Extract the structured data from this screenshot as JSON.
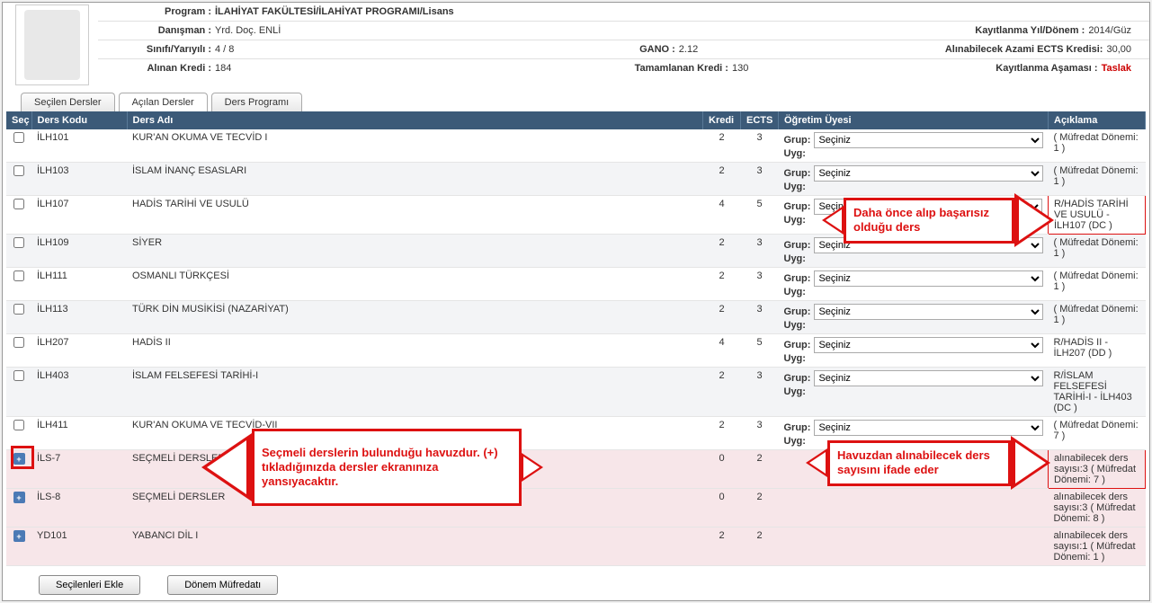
{
  "header": {
    "program_lbl": "Program :",
    "program_val": "İLAHİYAT FAKÜLTESİ/İLAHİYAT PROGRAMI/Lisans",
    "danisman_lbl": "Danışman :",
    "danisman_val": "Yrd. Doç.                ENLİ",
    "sinif_lbl": "Sınıfı/Yarıyılı :",
    "sinif_val": "4 / 8",
    "kredi_lbl": "Alınan Kredi :",
    "kredi_val": "184",
    "kayit_yil_lbl": "Kayıtlanma Yıl/Dönem :",
    "kayit_yil_val": "2014/Güz",
    "gano_lbl": "GANO :",
    "gano_val": "2.12",
    "azami_lbl": "Alınabilecek Azami ECTS Kredisi:",
    "azami_val": "30,00",
    "tamam_kredi_lbl": "Tamamlanan Kredi :",
    "tamam_kredi_val": "130",
    "asama_lbl": "Kayıtlanma Aşaması :",
    "asama_val": "Taslak"
  },
  "tabs": {
    "t1": "Seçilen Dersler",
    "t2": "Açılan Dersler",
    "t3": "Ders Programı"
  },
  "thead": {
    "sec": "Seç",
    "kod": "Ders Kodu",
    "adi": "Ders Adı",
    "kredi": "Kredi",
    "ects": "ECTS",
    "ogr": "Öğretim Üyesi",
    "acik": "Açıklama"
  },
  "grup_lbl": "Grup:",
  "uyg_lbl": "Uyg:",
  "sel_placeholder": "Seçiniz",
  "rows": [
    {
      "kod": "İLH101",
      "adi": "KUR'AN OKUMA VE TECVİD I",
      "kredi": "2",
      "ects": "3",
      "grup": true,
      "acik": "( Müfredat Dönemi: 1 )",
      "cls": "odd"
    },
    {
      "kod": "İLH103",
      "adi": "İSLAM İNANÇ ESASLARI",
      "kredi": "2",
      "ects": "3",
      "grup": true,
      "acik": "( Müfredat Dönemi: 1 )",
      "cls": "even"
    },
    {
      "kod": "İLH107",
      "adi": "HADİS TARİHİ VE USULÜ",
      "kredi": "4",
      "ects": "5",
      "grup": true,
      "acik": "R/HADİS TARİHİ VE USULÜ - İLH107 (DC )",
      "cls": "odd",
      "acik_red": true
    },
    {
      "kod": "İLH109",
      "adi": "SİYER",
      "kredi": "2",
      "ects": "3",
      "grup": true,
      "acik": "( Müfredat Dönemi: 1 )",
      "cls": "even"
    },
    {
      "kod": "İLH111",
      "adi": "OSMANLI TÜRKÇESİ",
      "kredi": "2",
      "ects": "3",
      "grup": true,
      "acik": "( Müfredat Dönemi: 1 )",
      "cls": "odd"
    },
    {
      "kod": "İLH113",
      "adi": "TÜRK DİN MUSİKİSİ (NAZARİYAT)",
      "kredi": "2",
      "ects": "3",
      "grup": true,
      "acik": "( Müfredat Dönemi: 1 )",
      "cls": "even"
    },
    {
      "kod": "İLH207",
      "adi": "HADİS II",
      "kredi": "4",
      "ects": "5",
      "grup": true,
      "acik": "R/HADİS II - İLH207 (DD )",
      "cls": "odd"
    },
    {
      "kod": "İLH403",
      "adi": "İSLAM FELSEFESİ TARİHİ-I",
      "kredi": "2",
      "ects": "3",
      "grup": true,
      "acik": "R/İSLAM FELSEFESİ TARİHİ-I - İLH403 (DC )",
      "cls": "even"
    },
    {
      "kod": "İLH411",
      "adi": "KUR'AN OKUMA VE TECVİD-VII",
      "kredi": "2",
      "ects": "3",
      "grup": true,
      "acik": "( Müfredat Dönemi: 7 )",
      "cls": "odd"
    },
    {
      "kod": "İLS-7",
      "adi": "SEÇMELİ DERSLER",
      "kredi": "0",
      "ects": "2",
      "grup": false,
      "plus": true,
      "acik": "alınabilecek ders sayısı:3 ( Müfredat Dönemi: 7 )",
      "cls": "pink",
      "acik_red": true
    },
    {
      "kod": "İLS-8",
      "adi": "SEÇMELİ DERSLER",
      "kredi": "0",
      "ects": "2",
      "grup": false,
      "plus": true,
      "acik": "alınabilecek ders sayısı:3 ( Müfredat Dönemi: 8 )",
      "cls": "pink"
    },
    {
      "kod": "YD101",
      "adi": "YABANCI DİL I",
      "kredi": "2",
      "ects": "2",
      "grup": false,
      "plus": true,
      "acik": "alınabilecek ders sayısı:1 ( Müfredat Dönemi: 1 )",
      "cls": "pink"
    }
  ],
  "buttons": {
    "ekle": "Seçilenleri Ekle",
    "mufredat": "Dönem Müfredatı"
  },
  "anno": {
    "a1": "Daha önce alıp başarısız olduğu ders",
    "a2": "Seçmeli derslerin bulunduğu havuzdur. (+) tıkladığınızda dersler ekranınıza yansıyacaktır.",
    "a3": "Havuzdan alınabilecek ders sayısını ifade eder"
  }
}
